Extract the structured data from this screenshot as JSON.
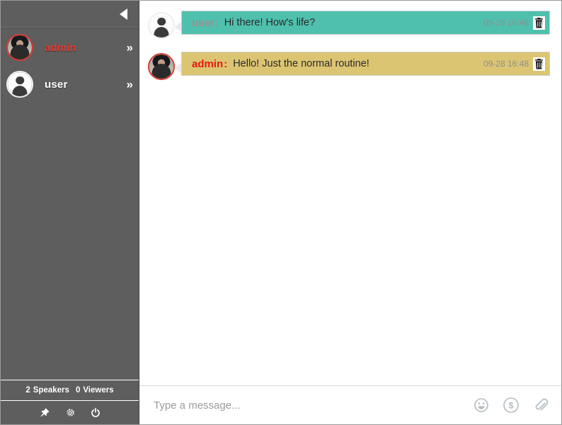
{
  "sidebar": {
    "collapse_icon": "triangle-left-icon",
    "users": [
      {
        "name": "admin",
        "role": "admin",
        "avatar": "photo-avatar",
        "expand_icon": "»"
      },
      {
        "name": "user",
        "role": "user",
        "avatar": "default-avatar",
        "expand_icon": "»"
      }
    ],
    "stats": {
      "speakers_count": "2",
      "speakers_label": "Speakers",
      "viewers_count": "0",
      "viewers_label": "Viewers"
    },
    "tools": [
      {
        "name": "pin-icon"
      },
      {
        "name": "gear-icon"
      },
      {
        "name": "power-icon"
      }
    ]
  },
  "chat": {
    "messages": [
      {
        "sender": "user",
        "separator": ":",
        "text": "Hi there! How's life?",
        "time": "09-28 16:48",
        "avatar": "default-avatar",
        "bubble_color": "#4fc0ad",
        "delete_icon": "trash-icon"
      },
      {
        "sender": "admin",
        "separator": ":",
        "text": "Hello! Just the normal routine!",
        "time": "09-28 16:48",
        "avatar": "photo-avatar",
        "bubble_color": "#dcc572",
        "delete_icon": "trash-icon"
      }
    ]
  },
  "composer": {
    "placeholder": "Type a message...",
    "value": "",
    "actions": [
      {
        "name": "emoji-icon"
      },
      {
        "name": "tip-dollar-icon"
      },
      {
        "name": "attachment-icon"
      }
    ]
  },
  "colors": {
    "sidebar_bg": "#5e5e5e",
    "admin_name": "#e8392e",
    "bubble_teal": "#4fc0ad",
    "bubble_tan": "#dcc572"
  }
}
